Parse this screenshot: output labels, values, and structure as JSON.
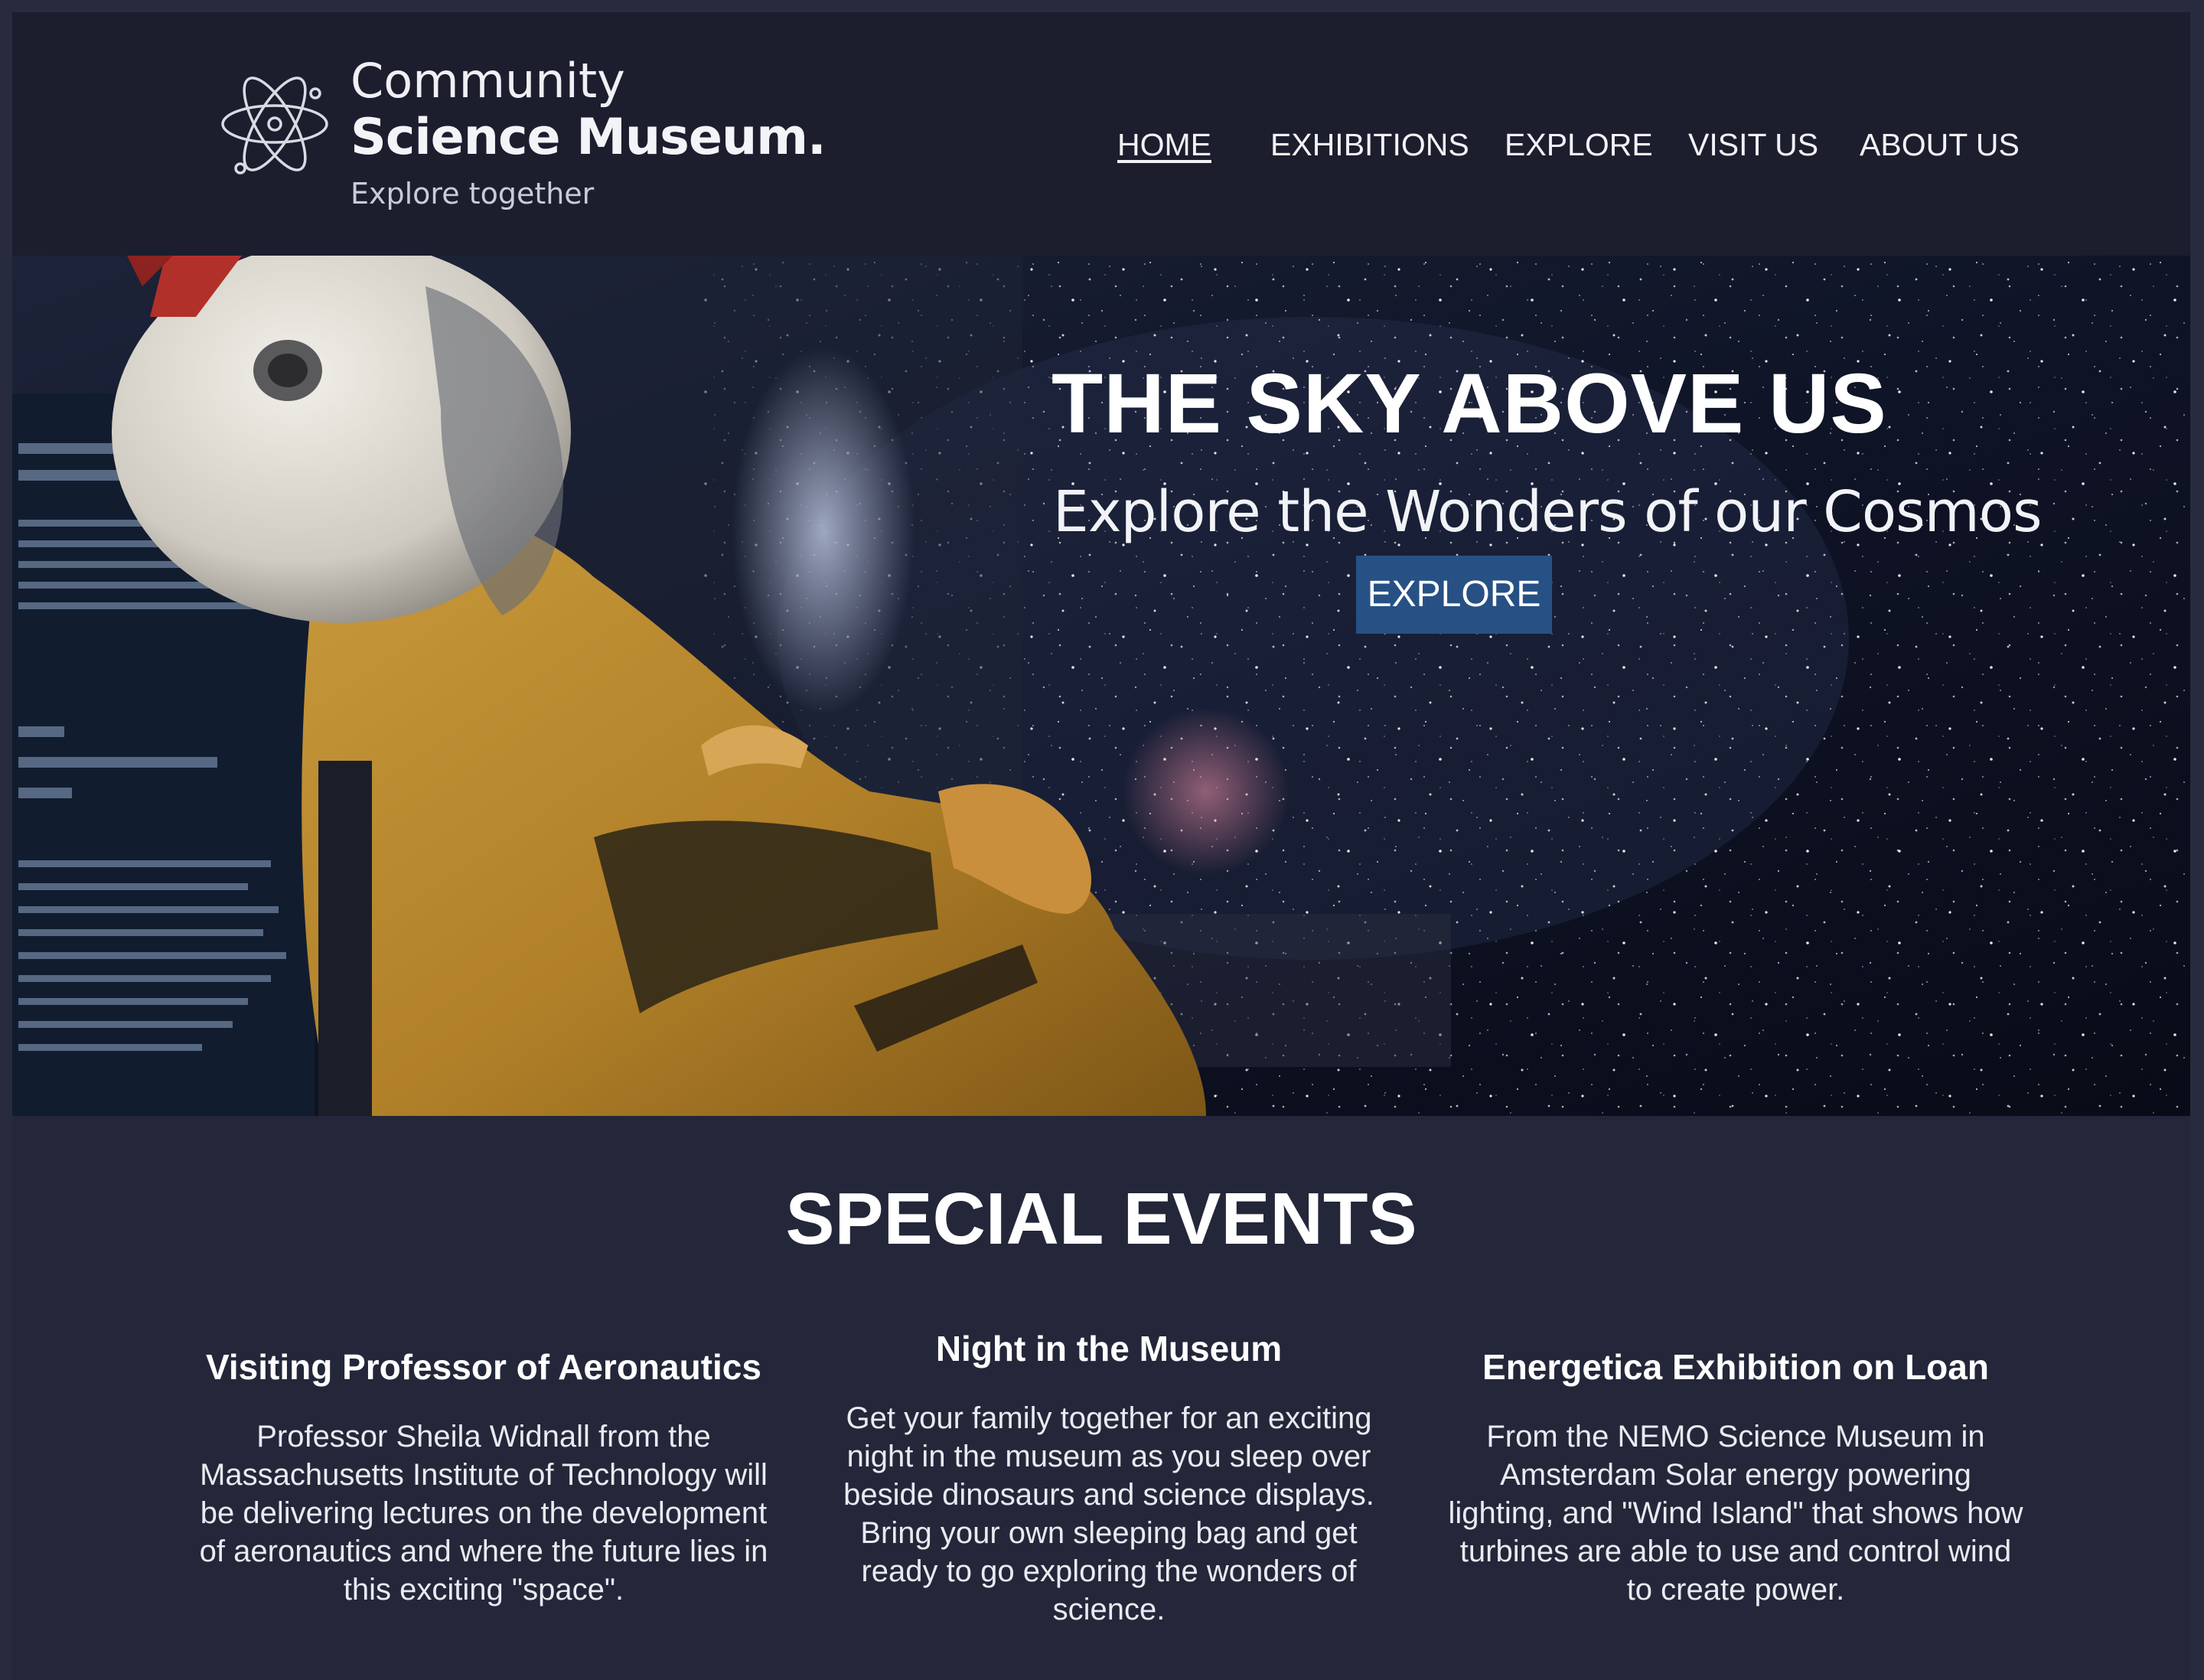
{
  "header": {
    "logo": {
      "line1": "Community",
      "line2": "Science Museum.",
      "tagline": "Explore together"
    },
    "nav": [
      {
        "label": "HOME",
        "active": true
      },
      {
        "label": "EXHIBITIONS",
        "active": false
      },
      {
        "label": "EXPLORE",
        "active": false
      },
      {
        "label": "VISIT US",
        "active": false
      },
      {
        "label": "ABOUT US",
        "active": false
      }
    ]
  },
  "hero": {
    "title": "THE SKY ABOVE US",
    "subtitle": "Explore the Wonders of our Cosmos",
    "button_label": "EXPLORE",
    "button_color": "#275185"
  },
  "events": {
    "heading": "SPECIAL EVENTS",
    "items": [
      {
        "title": "Visiting Professor of Aeronautics",
        "body": "Professor Sheila Widnall from the Massachusetts Institute of Technology will be delivering lectures on the development of aeronautics and where the future lies in this exciting \"space\"."
      },
      {
        "title": "Night in the Museum",
        "body": "Get your family together for an exciting night in the museum as you sleep over beside dinosaurs and science displays. Bring your own sleeping bag and get ready to go exploring the wonders of science."
      },
      {
        "title": "Energetica Exhibition on Loan",
        "body": "From the NEMO Science Museum in Amsterdam Solar energy powering lighting, and \"Wind Island\" that shows how turbines are able to use and control wind to create power."
      }
    ]
  },
  "colors": {
    "header_bg": "#1c1e2e",
    "page_bg": "#232739"
  }
}
